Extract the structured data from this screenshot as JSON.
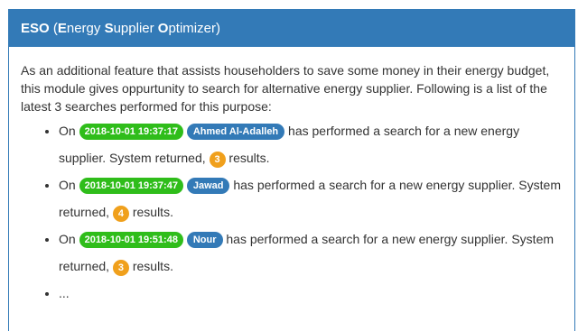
{
  "panel": {
    "title_abbr": "ESO",
    "title_rest_prefix": " (",
    "title_E": "E",
    "title_nergy": "nergy ",
    "title_S": "S",
    "title_upplier": "upplier ",
    "title_O": "O",
    "title_ptimizer": "ptimizer)",
    "intro": "As an additional feature that assists householders to save some money in their energy budget, this module gives oppurtunity to search for alternative energy supplier. Following is a list of the latest 3 searches performed for this purpose:"
  },
  "searches": [
    {
      "prefix": "On",
      "date": "2018-10-01 19:37:17",
      "user": "Ahmed Al-Adalleh",
      "middle": "has performed a search for a new energy supplier. System returned,",
      "count": "3",
      "suffix": "results."
    },
    {
      "prefix": "On",
      "date": "2018-10-01 19:37:47",
      "user": "Jawad",
      "middle": "has performed a search for a new energy supplier. System returned,",
      "count": "4",
      "suffix": "results."
    },
    {
      "prefix": "On",
      "date": "2018-10-01 19:51:48",
      "user": "Nour",
      "middle": "has performed a search for a new energy supplier. System returned,",
      "count": "3",
      "suffix": "results."
    }
  ],
  "ellipsis": "...",
  "colors": {
    "header": "#337ab7",
    "date_label": "#2fbd1a",
    "user_label": "#337ab7",
    "count_badge": "#f0a01c"
  }
}
